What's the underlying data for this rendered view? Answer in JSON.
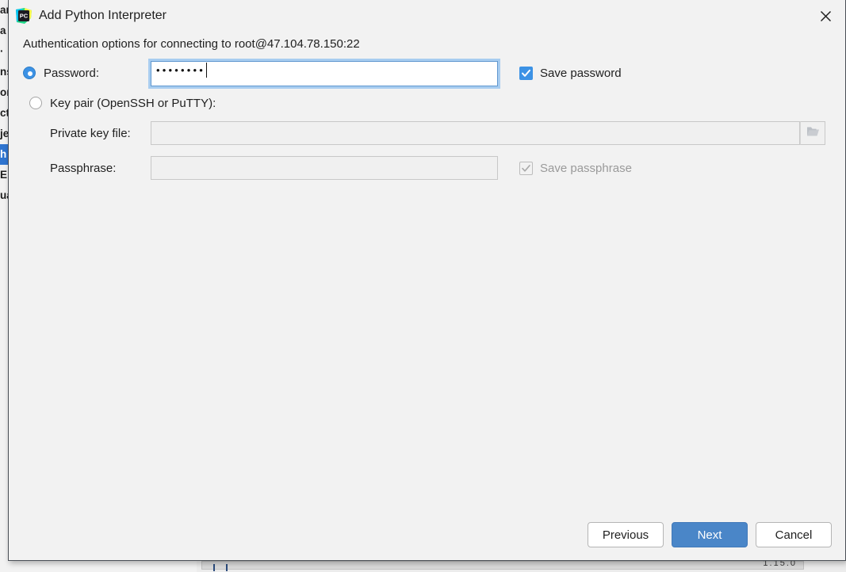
{
  "dialog": {
    "title": "Add Python Interpreter",
    "icon": "pycharm-logo-icon",
    "close_icon": "close-icon",
    "subtitle": "Authentication options for connecting to root@47.104.78.150:22"
  },
  "auth": {
    "mode": "password",
    "password_option": {
      "label": "Password:",
      "selected": true,
      "value": "••••••••",
      "masked_char_count": 8,
      "focused": true
    },
    "save_password": {
      "label": "Save password",
      "checked": true,
      "enabled": true,
      "icon": "checkmark-icon"
    },
    "keypair_option": {
      "label": "Key pair (OpenSSH or PuTTY):",
      "selected": false
    },
    "private_key_file": {
      "label": "Private key file:",
      "value": "",
      "placeholder": "",
      "enabled": false,
      "browse_icon": "folder-icon"
    },
    "passphrase": {
      "label": "Passphrase:",
      "value": "",
      "placeholder": "",
      "enabled": false
    },
    "save_passphrase": {
      "label": "Save passphrase",
      "checked": true,
      "enabled": false,
      "icon": "checkmark-icon"
    }
  },
  "buttons": {
    "previous": "Previous",
    "next": "Next",
    "cancel": "Cancel"
  },
  "colors": {
    "accent_blue": "#3c92e5",
    "primary_button": "#4a86c8",
    "dialog_bg": "#f2f2f2",
    "focus_ring": "#a8cdf0",
    "selection_blue": "#2f75d0",
    "disabled_text": "#9a9a9a"
  },
  "background_app": {
    "tree_fragments": [
      "ar",
      "a",
      "·",
      "ns",
      "or",
      "ct",
      "je",
      "h",
      "E",
      "ua"
    ],
    "selected_fragment_index": 7,
    "status_number": "1.15.0"
  }
}
